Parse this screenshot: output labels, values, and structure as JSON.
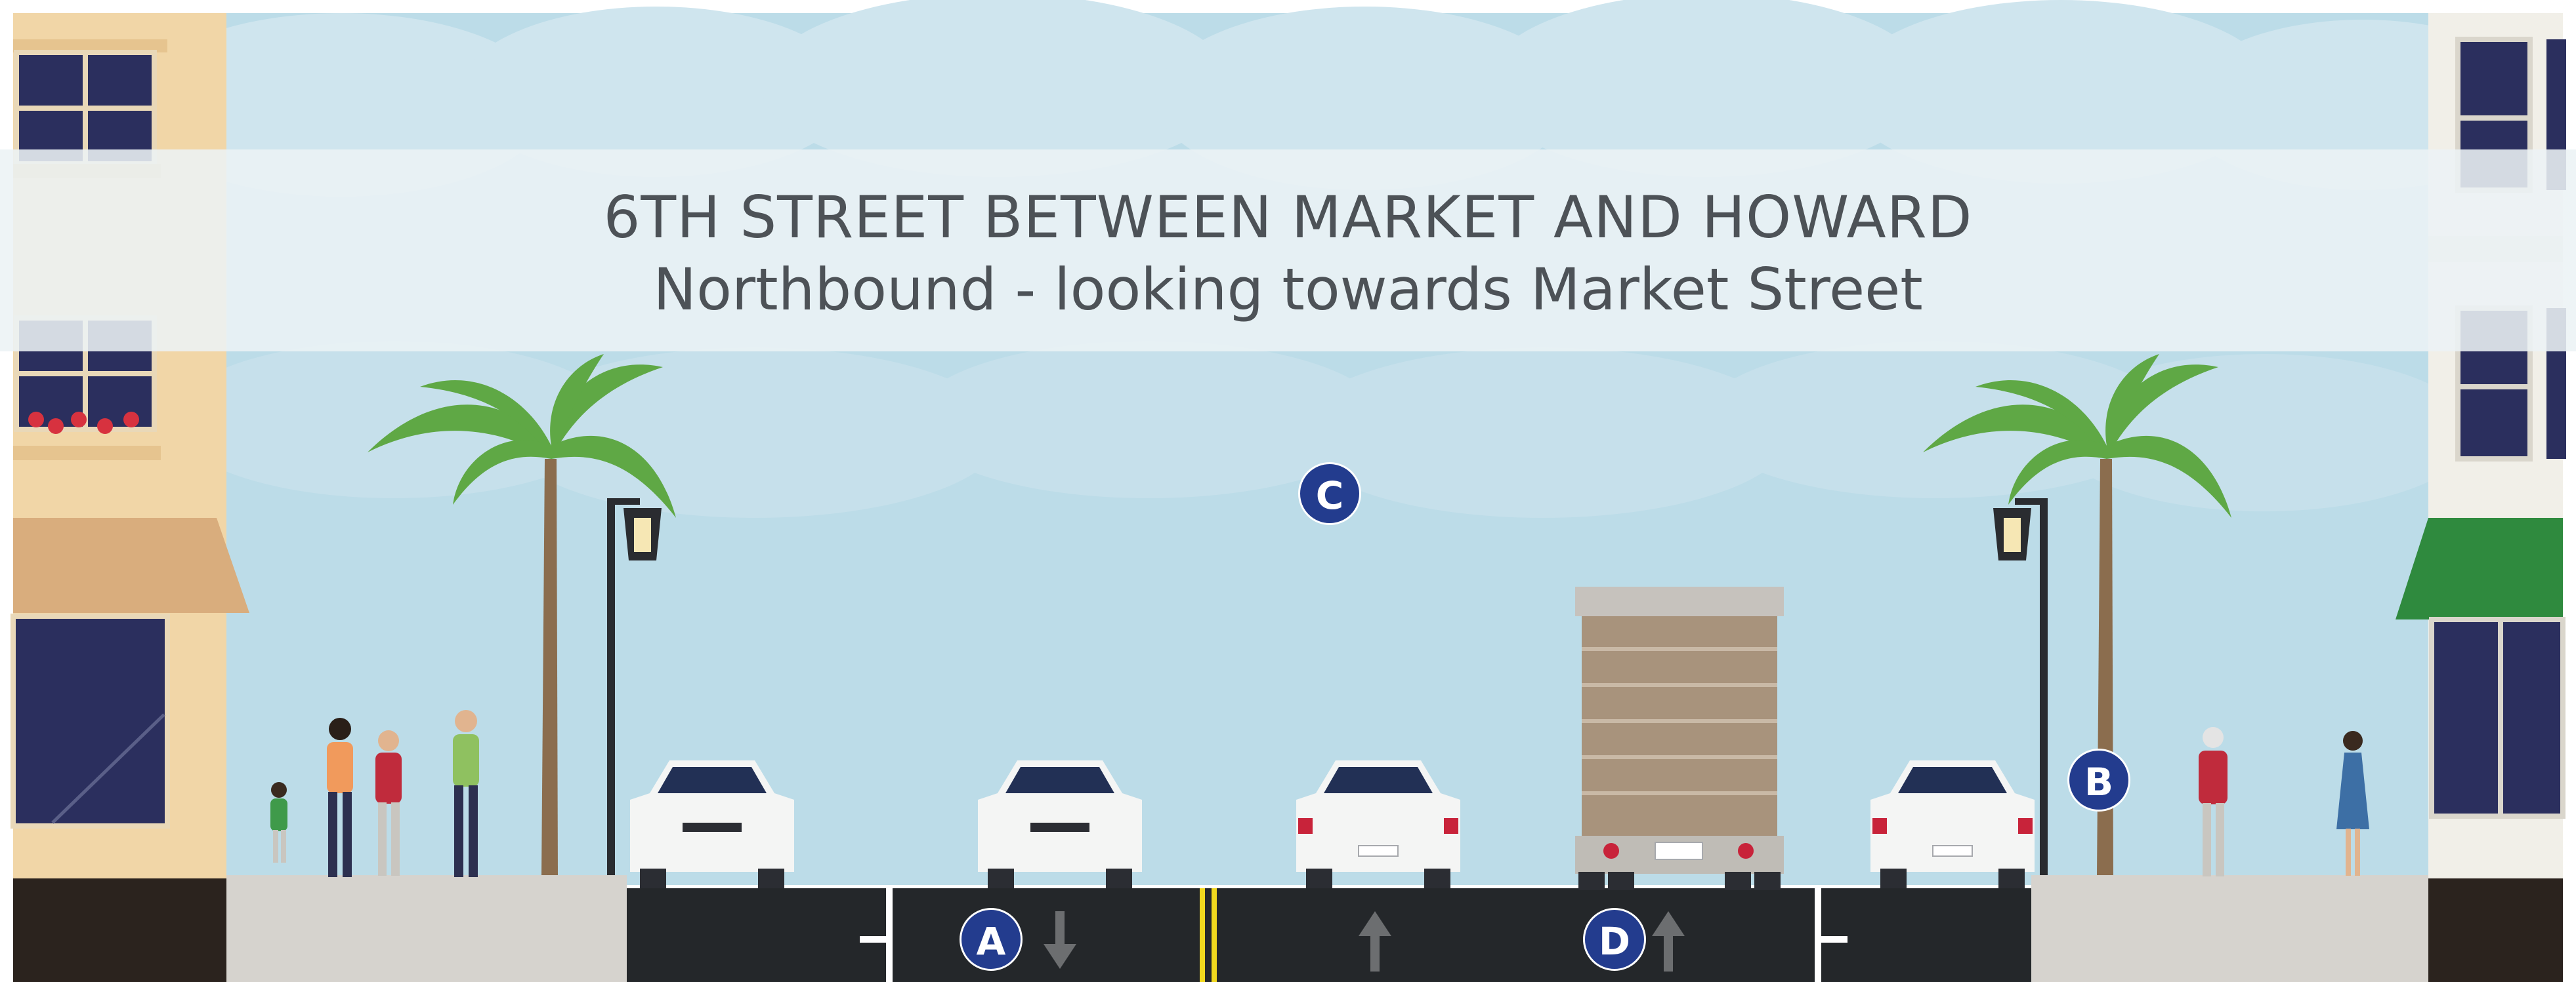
{
  "title": {
    "line1": "6TH STREET BETWEEN MARKET AND HOWARD",
    "line2": "Northbound - looking towards Market Street"
  },
  "markers": {
    "a": "A",
    "b": "B",
    "c": "C",
    "d": "D"
  },
  "colors": {
    "sky": "#bcdce8",
    "cloud": "#d8ebf2",
    "road": "#24272a",
    "sidewalk": "#d6d3ce",
    "centerline": "#f1d81e",
    "marker_badge": "#233c8e",
    "palm_leaf": "#5fa845",
    "left_building": "#f1d6a7",
    "right_building": "#f1efe8",
    "awning_left": "#d9ad7d",
    "awning_right": "#2f8a3e",
    "truck_box": "#a8937c"
  },
  "lane_arrows": [
    "down",
    "up",
    "up"
  ]
}
